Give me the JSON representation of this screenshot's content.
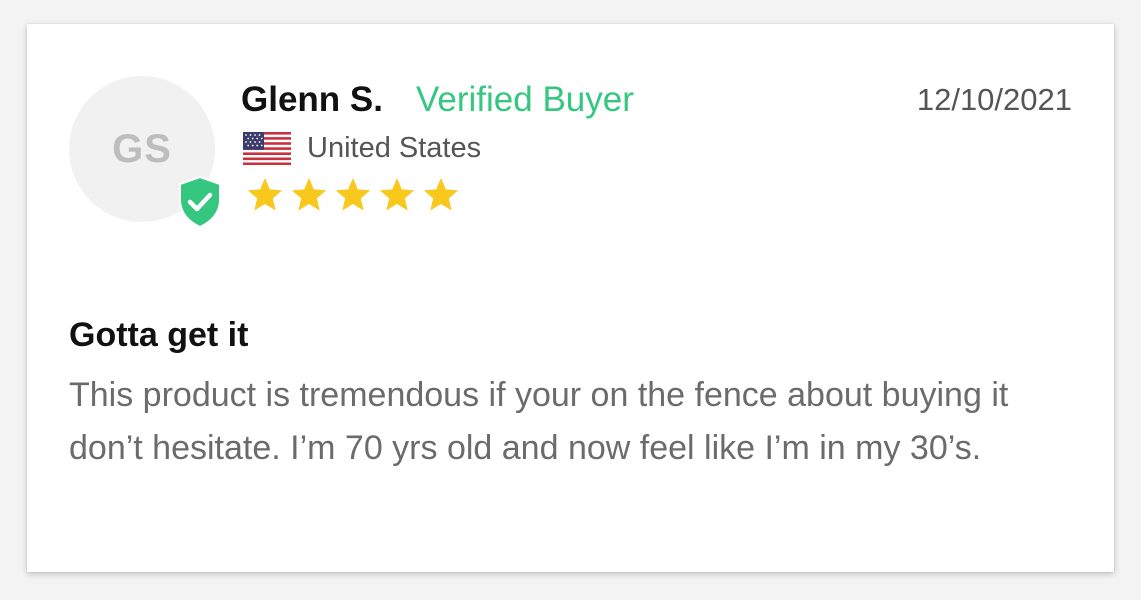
{
  "review": {
    "initials": "GS",
    "reviewer_name": "Glenn S.",
    "verified_label": "Verified Buyer",
    "date": "12/10/2021",
    "country": "United States",
    "rating": 5,
    "rating_max": 5,
    "title": "Gotta get it",
    "body": "This product is tremendous if your on the fence about buying it don’t hesitate. I’m 70 yrs old and now feel like I’m in my 30’s."
  },
  "icons": {
    "badge": "verified-shield-check-icon",
    "flag": "us-flag-icon",
    "star": "star-icon"
  },
  "colors": {
    "verified_green": "#35c77f",
    "star_gold": "#f8c81c",
    "avatar_bg": "#f1f1f1",
    "avatar_text": "#bdbdbd"
  }
}
